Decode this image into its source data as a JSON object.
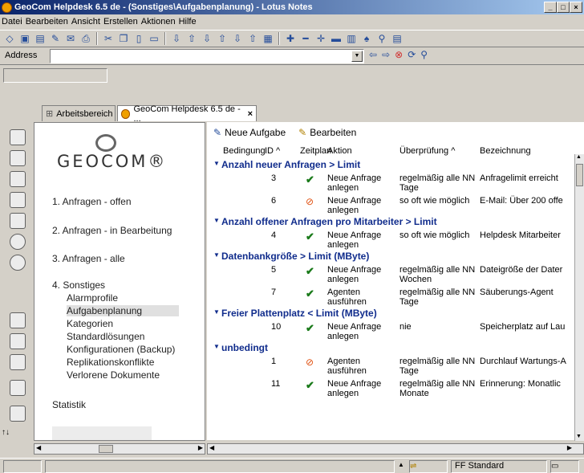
{
  "window": {
    "title": "GeoCom Helpdesk 6.5 de - (Sonstiges\\Aufgabenplanung) - Lotus Notes",
    "controls": [
      "_",
      "□",
      "×"
    ]
  },
  "menu": [
    "Datei",
    "Bearbeiten",
    "Ansicht",
    "Erstellen",
    "Aktionen",
    "Hilfe"
  ],
  "address": {
    "label": "Address",
    "value": ""
  },
  "tabs": [
    {
      "label": "Arbeitsbereich"
    },
    {
      "label": "GeoCom Helpdesk 6.5 de - ..."
    }
  ],
  "nav": {
    "logo": "GEOCOM®",
    "items": [
      "1. Anfragen - offen",
      "2. Anfragen - in Bearbeitung",
      "3. Anfragen - alle",
      "4. Sonstiges"
    ],
    "subitems": [
      "Alarmprofile",
      "Aufgabenplanung",
      "Kategorien",
      "Standardlösungen",
      "Konfigurationen (Backup)",
      "Replikationskonflikte",
      "Verlorene Dokumente"
    ],
    "statistik": "Statistik"
  },
  "actions": {
    "new_task": "Neue Aufgabe",
    "edit": "Bearbeiten"
  },
  "columns": {
    "bedingung": "Bedingung",
    "id": "ID ^",
    "zeitplan": "Zeitplan",
    "aktion": "Aktion",
    "pruefung": "Überprüfung ^",
    "bezeichnung": "Bezeichnung"
  },
  "groups": [
    {
      "category": "Anzahl neuer Anfragen > Limit",
      "rows": [
        {
          "id": "3",
          "status": "check",
          "aktion": "Neue Anfrage anlegen",
          "pruefung": "regelmäßig alle NN Tage",
          "bezeichnung": "Anfragelimit erreicht"
        }
      ]
    },
    {
      "category": "",
      "rows": [
        {
          "id": "6",
          "status": "stop",
          "aktion": "Neue Anfrage anlegen",
          "pruefung": "so oft wie möglich",
          "bezeichnung": "E-Mail: Über 200 offe"
        }
      ]
    },
    {
      "category": "Anzahl offener Anfragen pro Mitarbeiter > Limit",
      "rows": [
        {
          "id": "4",
          "status": "check",
          "aktion": "Neue Anfrage anlegen",
          "pruefung": "so oft wie möglich",
          "bezeichnung": "Helpdesk Mitarbeiter"
        }
      ]
    },
    {
      "category": "Datenbankgröße > Limit (MByte)",
      "rows": [
        {
          "id": "5",
          "status": "check",
          "aktion": "Neue Anfrage anlegen",
          "pruefung": "regelmäßig alle NN Wochen",
          "bezeichnung": "Dateigröße der Dater"
        },
        {
          "id": "7",
          "status": "check",
          "aktion": "Agenten ausführen",
          "pruefung": "regelmäßig alle NN Tage",
          "bezeichnung": "Säuberungs-Agent"
        }
      ]
    },
    {
      "category": "Freier Plattenplatz < Limit (MByte)",
      "rows": [
        {
          "id": "10",
          "status": "check",
          "aktion": "Neue Anfrage anlegen",
          "pruefung": "nie",
          "bezeichnung": "Speicherplatz auf Lau"
        }
      ]
    },
    {
      "category": "unbedingt",
      "rows": [
        {
          "id": "1",
          "status": "stop",
          "aktion": "Agenten ausführen",
          "pruefung": "regelmäßig alle NN Tage",
          "bezeichnung": "Durchlauf Wartungs-A"
        },
        {
          "id": "11",
          "status": "check",
          "aktion": "Neue Anfrage anlegen",
          "pruefung": "regelmäßig alle NN Monate",
          "bezeichnung": "Erinnerung: Monatlic"
        }
      ]
    }
  ],
  "status": {
    "location": "FF Standard"
  }
}
